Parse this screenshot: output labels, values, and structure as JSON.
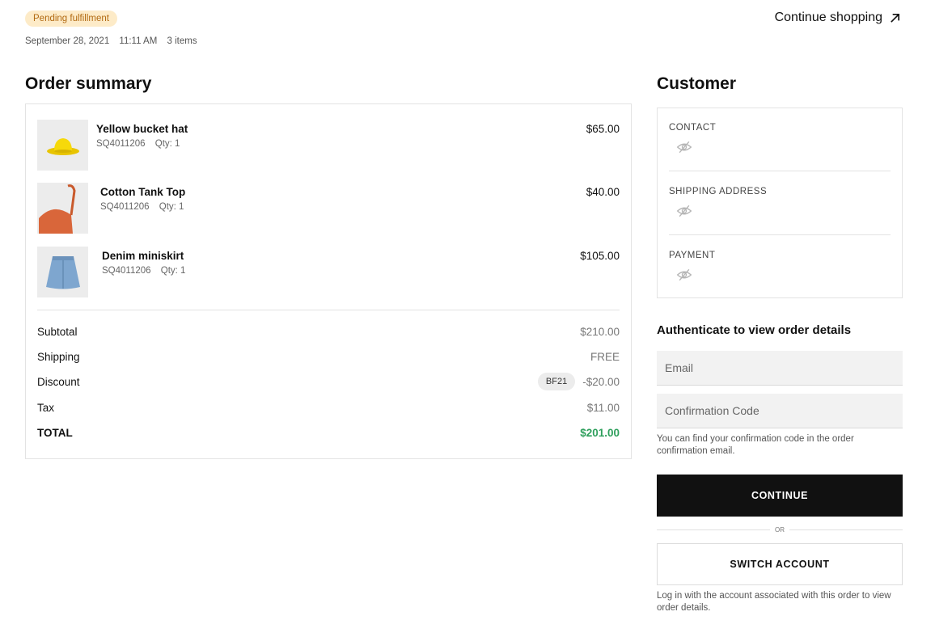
{
  "header": {
    "status_badge": "Pending fulfillment",
    "date": "September 28, 2021",
    "time": "11:11 AM",
    "items_count": "3 items",
    "continue_shopping": "Continue shopping"
  },
  "order_summary": {
    "title": "Order summary",
    "items": [
      {
        "name": "Yellow bucket hat",
        "sku": "SQ4011206",
        "qty": "Qty: 1",
        "price": "$65.00"
      },
      {
        "name": "Cotton Tank Top",
        "sku": "SQ4011206",
        "qty": "Qty: 1",
        "price": "$40.00"
      },
      {
        "name": "Denim miniskirt",
        "sku": "SQ4011206",
        "qty": "Qty: 1",
        "price": "$105.00"
      }
    ],
    "totals": {
      "subtotal_label": "Subtotal",
      "subtotal": "$210.00",
      "shipping_label": "Shipping",
      "shipping": "FREE",
      "discount_label": "Discount",
      "discount_code": "BF21",
      "discount": "-$20.00",
      "tax_label": "Tax",
      "tax": "$11.00",
      "total_label": "TOTAL",
      "total": "$201.00"
    }
  },
  "customer": {
    "title": "Customer",
    "sections": [
      {
        "label": "CONTACT"
      },
      {
        "label": "SHIPPING ADDRESS"
      },
      {
        "label": "PAYMENT"
      }
    ]
  },
  "auth": {
    "title": "Authenticate to view order details",
    "email_placeholder": "Email",
    "code_placeholder": "Confirmation Code",
    "code_hint": "You can find your confirmation code in the order confirmation email.",
    "continue_label": "CONTINUE",
    "or_label": "OR",
    "switch_label": "SWITCH ACCOUNT",
    "switch_hint": "Log in with the account associated with this order to view order details."
  },
  "colors": {
    "badge_bg": "#fdebc8",
    "badge_text": "#b26a12",
    "total_green": "#2e9f5c",
    "primary_button": "#111111"
  }
}
